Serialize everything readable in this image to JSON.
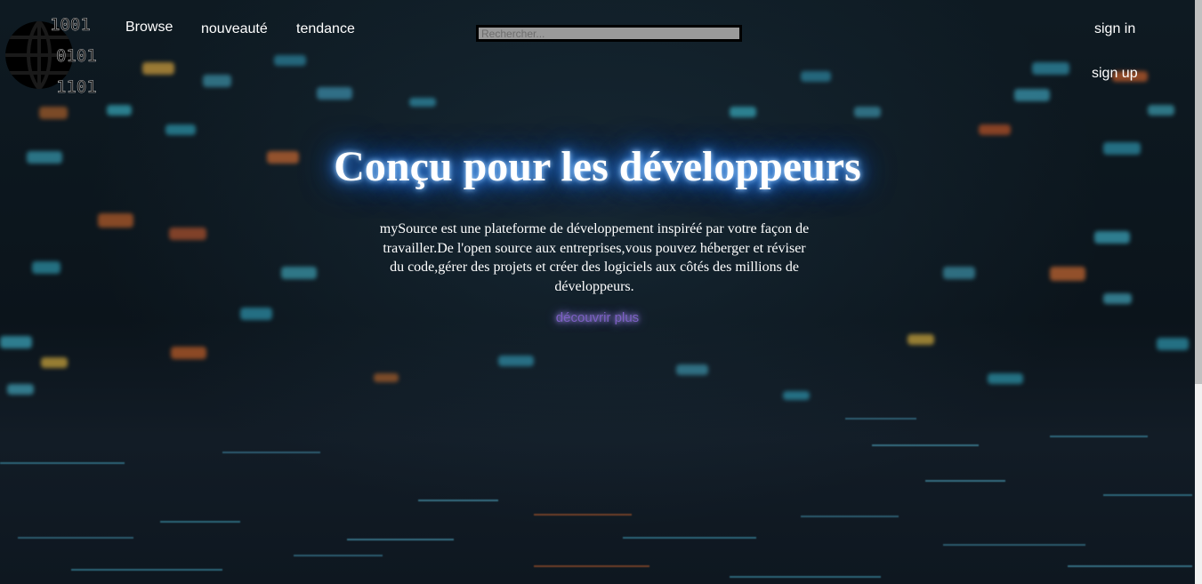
{
  "nav": {
    "browse": "Browse",
    "nouveaute": "nouveauté",
    "tendance": "tendance"
  },
  "search": {
    "placeholder": "Rechercher..."
  },
  "auth": {
    "sign_in": "sign in",
    "sign_up": "sign up"
  },
  "logo": {
    "bits": [
      "1001",
      "0101",
      "1101"
    ]
  },
  "hero": {
    "title": "Conçu pour les développeurs",
    "description": "mySource est une plateforme de développement inspiréé par votre façon de travailler.De l'open source aux entreprises,vous pouvez héberger et réviser du code,gérer des projets et créer des logiciels aux côtés des millions de développeurs.",
    "cta": "découvrir plus"
  },
  "colors": {
    "title_glow": "#1e74ff",
    "cta": "#7d5fc4",
    "search_bg": "#9a9a9a",
    "background": "#0d151d"
  }
}
